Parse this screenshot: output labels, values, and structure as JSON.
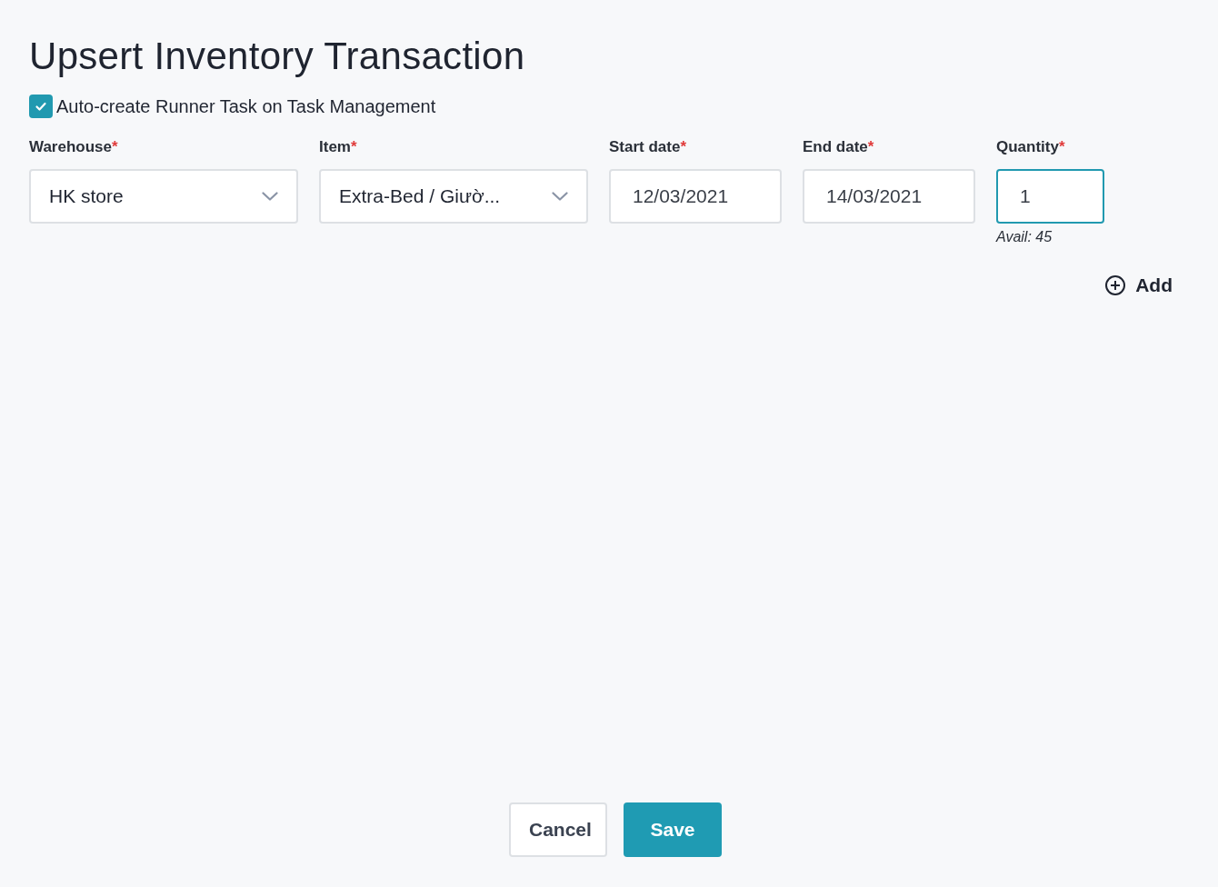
{
  "title": "Upsert Inventory Transaction",
  "auto_create": {
    "label": "Auto-create Runner Task on Task Management",
    "checked": true
  },
  "fields": [
    {
      "kind": "select",
      "label": "Warehouse",
      "required": "*",
      "value": "HK store",
      "focused": false
    },
    {
      "kind": "select",
      "label": "Item",
      "required": "*",
      "value": "Extra-Bed / Giườ...",
      "focused": false
    },
    {
      "kind": "date",
      "label": "Start date",
      "required": "*",
      "value": "12/03/2021",
      "focused": false
    },
    {
      "kind": "date",
      "label": "End date",
      "required": "*",
      "value": "14/03/2021",
      "focused": false
    },
    {
      "kind": "number",
      "label": "Quantity",
      "required": "*",
      "value": "1",
      "focused": true,
      "hint": "Avail: 45"
    }
  ],
  "add_button": "Add",
  "buttons": [
    {
      "label": "Cancel",
      "primary": false
    },
    {
      "label": "Save",
      "primary": true
    }
  ]
}
